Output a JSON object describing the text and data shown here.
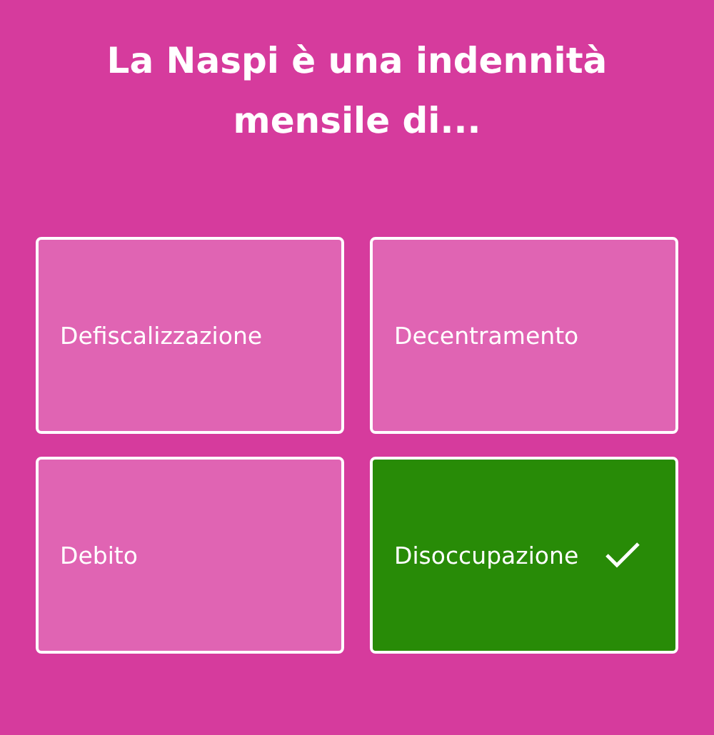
{
  "question": "La Naspi è una indennità mensile di...",
  "answers": [
    {
      "label": "Defiscalizzazione",
      "selected": false
    },
    {
      "label": "Decentramento",
      "selected": false
    },
    {
      "label": "Debito",
      "selected": false
    },
    {
      "label": "Disoccupazione",
      "selected": true
    }
  ]
}
